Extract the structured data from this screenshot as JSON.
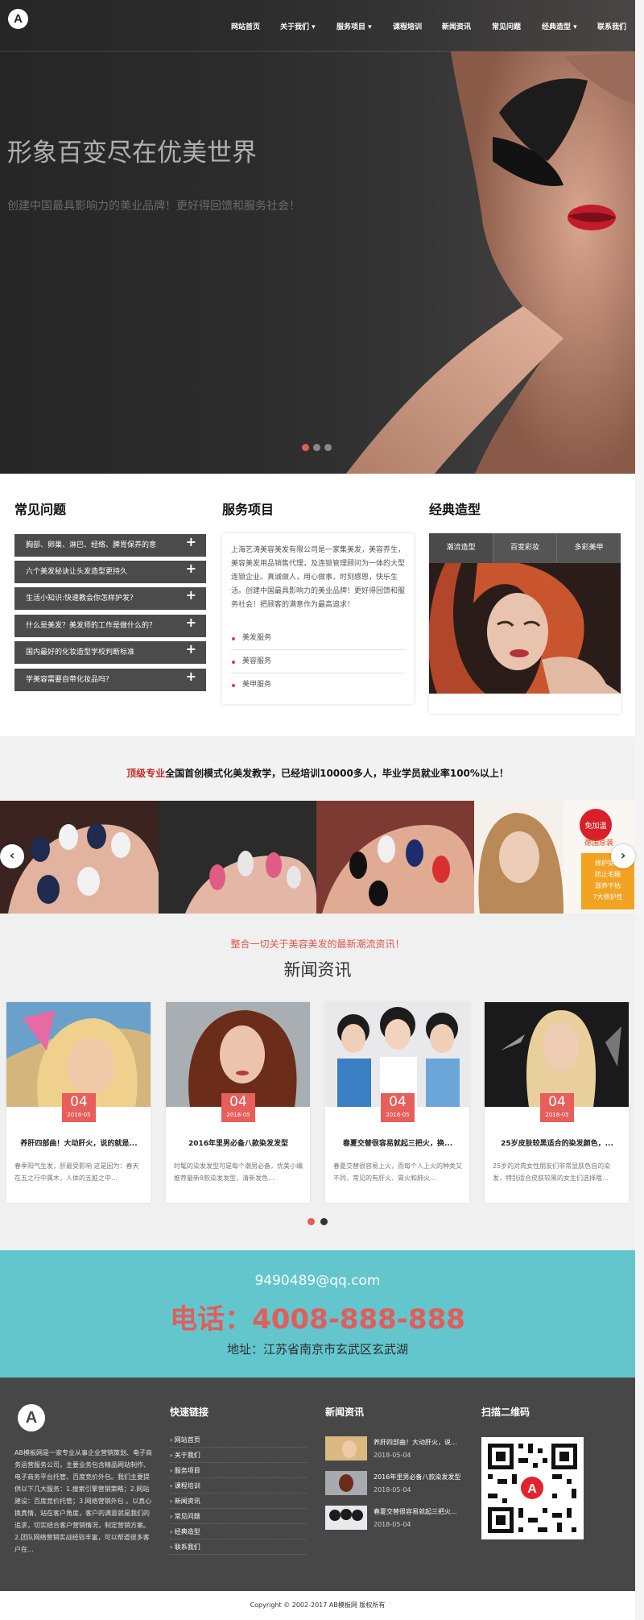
{
  "header": {
    "logo": "A",
    "nav": [
      {
        "label": "网站首页"
      },
      {
        "label": "关于我们 ▾"
      },
      {
        "label": "服务项目 ▾"
      },
      {
        "label": "课程培训"
      },
      {
        "label": "新闻资讯"
      },
      {
        "label": "常见问题"
      },
      {
        "label": "经典造型 ▾"
      },
      {
        "label": "联系我们"
      }
    ]
  },
  "hero": {
    "title": "形象百变尽在优美世界",
    "subtitle": "创建中国最具影响力的美业品牌！更好得回馈和服务社会！",
    "active_slide": 1,
    "slide_count": 3
  },
  "faq": {
    "title": "常见问题",
    "items": [
      {
        "label": "胸部、卵巢、淋巴、经络、脾胃保养的意"
      },
      {
        "label": "六个美发秘诀让头发造型更持久"
      },
      {
        "label": "生活小知识:快速教会你怎样护发？"
      },
      {
        "label": "什么是美发？美发师的工作是做什么的？"
      },
      {
        "label": "国内最好的化妆造型学校判断标准"
      },
      {
        "label": "学美容需要自带化妆品吗？"
      }
    ]
  },
  "services": {
    "title": "服务项目",
    "description": "上海艺涛美容美发有限公司是一家集美发，美容养生，美容美发用品销售代理，及连锁管理顾问为一体的大型连锁企业。真诚做人，用心做事，时刻感恩，快乐生活。创建中国最具影响力的美业品牌！更好得回馈和服务社会！把顾客的满意作为最高追求！",
    "links": [
      {
        "label": "美发服务"
      },
      {
        "label": "美容服务"
      },
      {
        "label": "美甲服务"
      }
    ]
  },
  "classic": {
    "title": "经典造型",
    "tabs": [
      {
        "label": "潮流造型"
      },
      {
        "label": "百变彩妆"
      },
      {
        "label": "多彩美甲"
      }
    ]
  },
  "banner": {
    "red": "顶级专业",
    "text": "全国首创模式化美发教学，已经培训10000多人，毕业学员就业率100%以上！"
  },
  "carousel": {
    "badge": "免加温",
    "product_title": "德国原装",
    "product_lines": [
      "修护受损",
      "防止毛糙",
      "滋养干枯",
      "7大修护性"
    ]
  },
  "news": {
    "tagline": "整合一切关于美容美发的最新潮流资讯！",
    "title": "新闻资讯",
    "items": [
      {
        "day": "04",
        "ym": "2018-05",
        "title": "养肝四部曲！大动肝火，说的就是...",
        "desc": "春季阳气生发，肝最受影响 这是因为：春天在五之行中属木，人体的五脏之中..."
      },
      {
        "day": "04",
        "ym": "2018-05",
        "title": "2016年里男必备八款染发发型",
        "desc": "时髦的染发发型可是每个潮男必备，优美小编推荐最新8款染发发型，清新发色..."
      },
      {
        "day": "04",
        "ym": "2018-05",
        "title": "春夏交替很容易就起三把火，换...",
        "desc": "春夏交替很容易上火，而每个人上火的种类又不同，常见的有肝火、胃火和肺火..."
      },
      {
        "day": "04",
        "ym": "2018-05",
        "title": "25岁皮肤较黑适合的染发颜色，...",
        "desc": "25岁的对肉女性朋友们非常显肤色自的染发，特别适合皮肤较黑的女生们选择哦..."
      }
    ],
    "active_page": 0
  },
  "contact": {
    "email": "9490489@qq.com",
    "phone": "电话：4008-888-888",
    "address": "地址：江苏省南京市玄武区玄武湖"
  },
  "footer": {
    "logo": "A",
    "about": "AB模板网是一家专业从事企业营销策划、电子商务运营服务公司，主要业务包含精品网站制作、电子商务平台托管、百度竞价外包。我们主要提供以下几大服务：1.搜索引擎营销策略；2.网站建设：百度竞价托管；3.网络营销外包 。以真心换真情，站在客户角度，客户的满意就是我们的追求，切实结合客户营销情况，制定营销方案。2.团队网络营销实战经验丰富，可以帮道很多客户在...",
    "links_title": "快速链接",
    "links": [
      {
        "label": "› 网站首页"
      },
      {
        "label": "› 关于我们"
      },
      {
        "label": "› 服务项目"
      },
      {
        "label": "› 课程培训"
      },
      {
        "label": "› 新闻资讯"
      },
      {
        "label": "› 常见问题"
      },
      {
        "label": "› 经典造型"
      },
      {
        "label": "› 联系我们"
      }
    ],
    "news_title": "新闻资讯",
    "news": [
      {
        "title": "养肝四部曲！大动肝火，说...",
        "date": "2018-05-04"
      },
      {
        "title": "2016年里男必备八款染发发型",
        "date": "2018-05-04"
      },
      {
        "title": "春夏交替很容易就起三把火...",
        "date": "2018-05-04"
      }
    ],
    "qr_title": "扫描二维码",
    "copyright": "Copyright © 2002-2017 AB模板网 版权所有"
  }
}
